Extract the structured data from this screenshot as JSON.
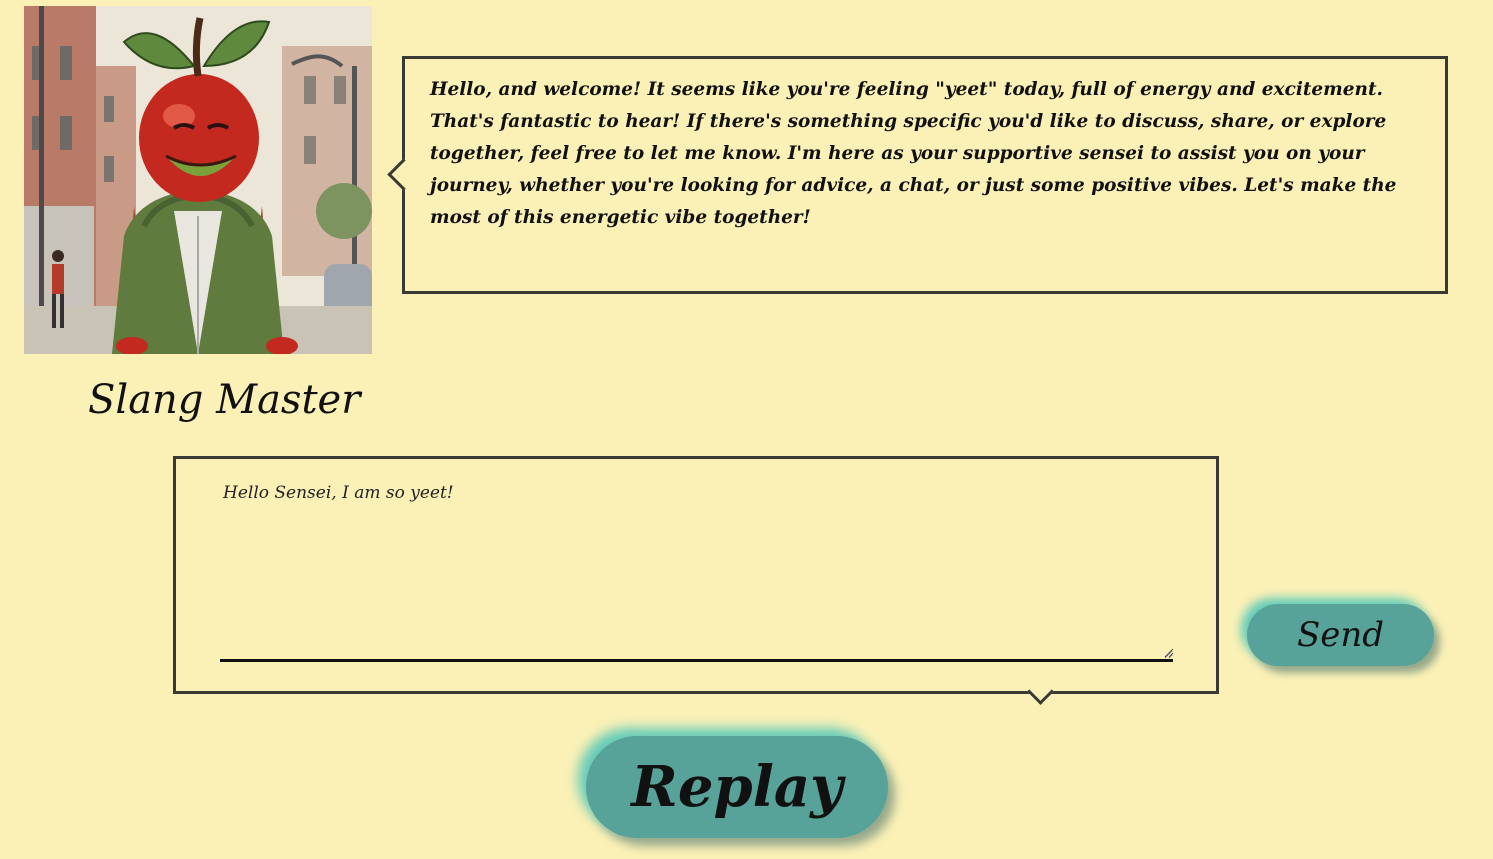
{
  "character": {
    "name": "Slang Master",
    "avatar_icon": "apple-head-character-portrait"
  },
  "reply": {
    "text": "Hello, and welcome! It seems like you're feeling \"yeet\" today, full of energy and excitement. That's fantastic to hear! If there's something specific you'd like to discuss, share, or explore together, feel free to let me know. I'm here as your supportive sensei to assist you on your journey, whether you're looking for advice, a chat, or just some positive vibes. Let's make the most of this energetic vibe together!"
  },
  "input": {
    "value": "Hello Sensei, I am so yeet!"
  },
  "buttons": {
    "send_label": "Send",
    "replay_label": "Replay"
  },
  "colors": {
    "background": "#fbf1b7",
    "bubble_border": "#3a3a35",
    "button_teal": "#57a39a",
    "button_glow": "#48c4b8"
  }
}
